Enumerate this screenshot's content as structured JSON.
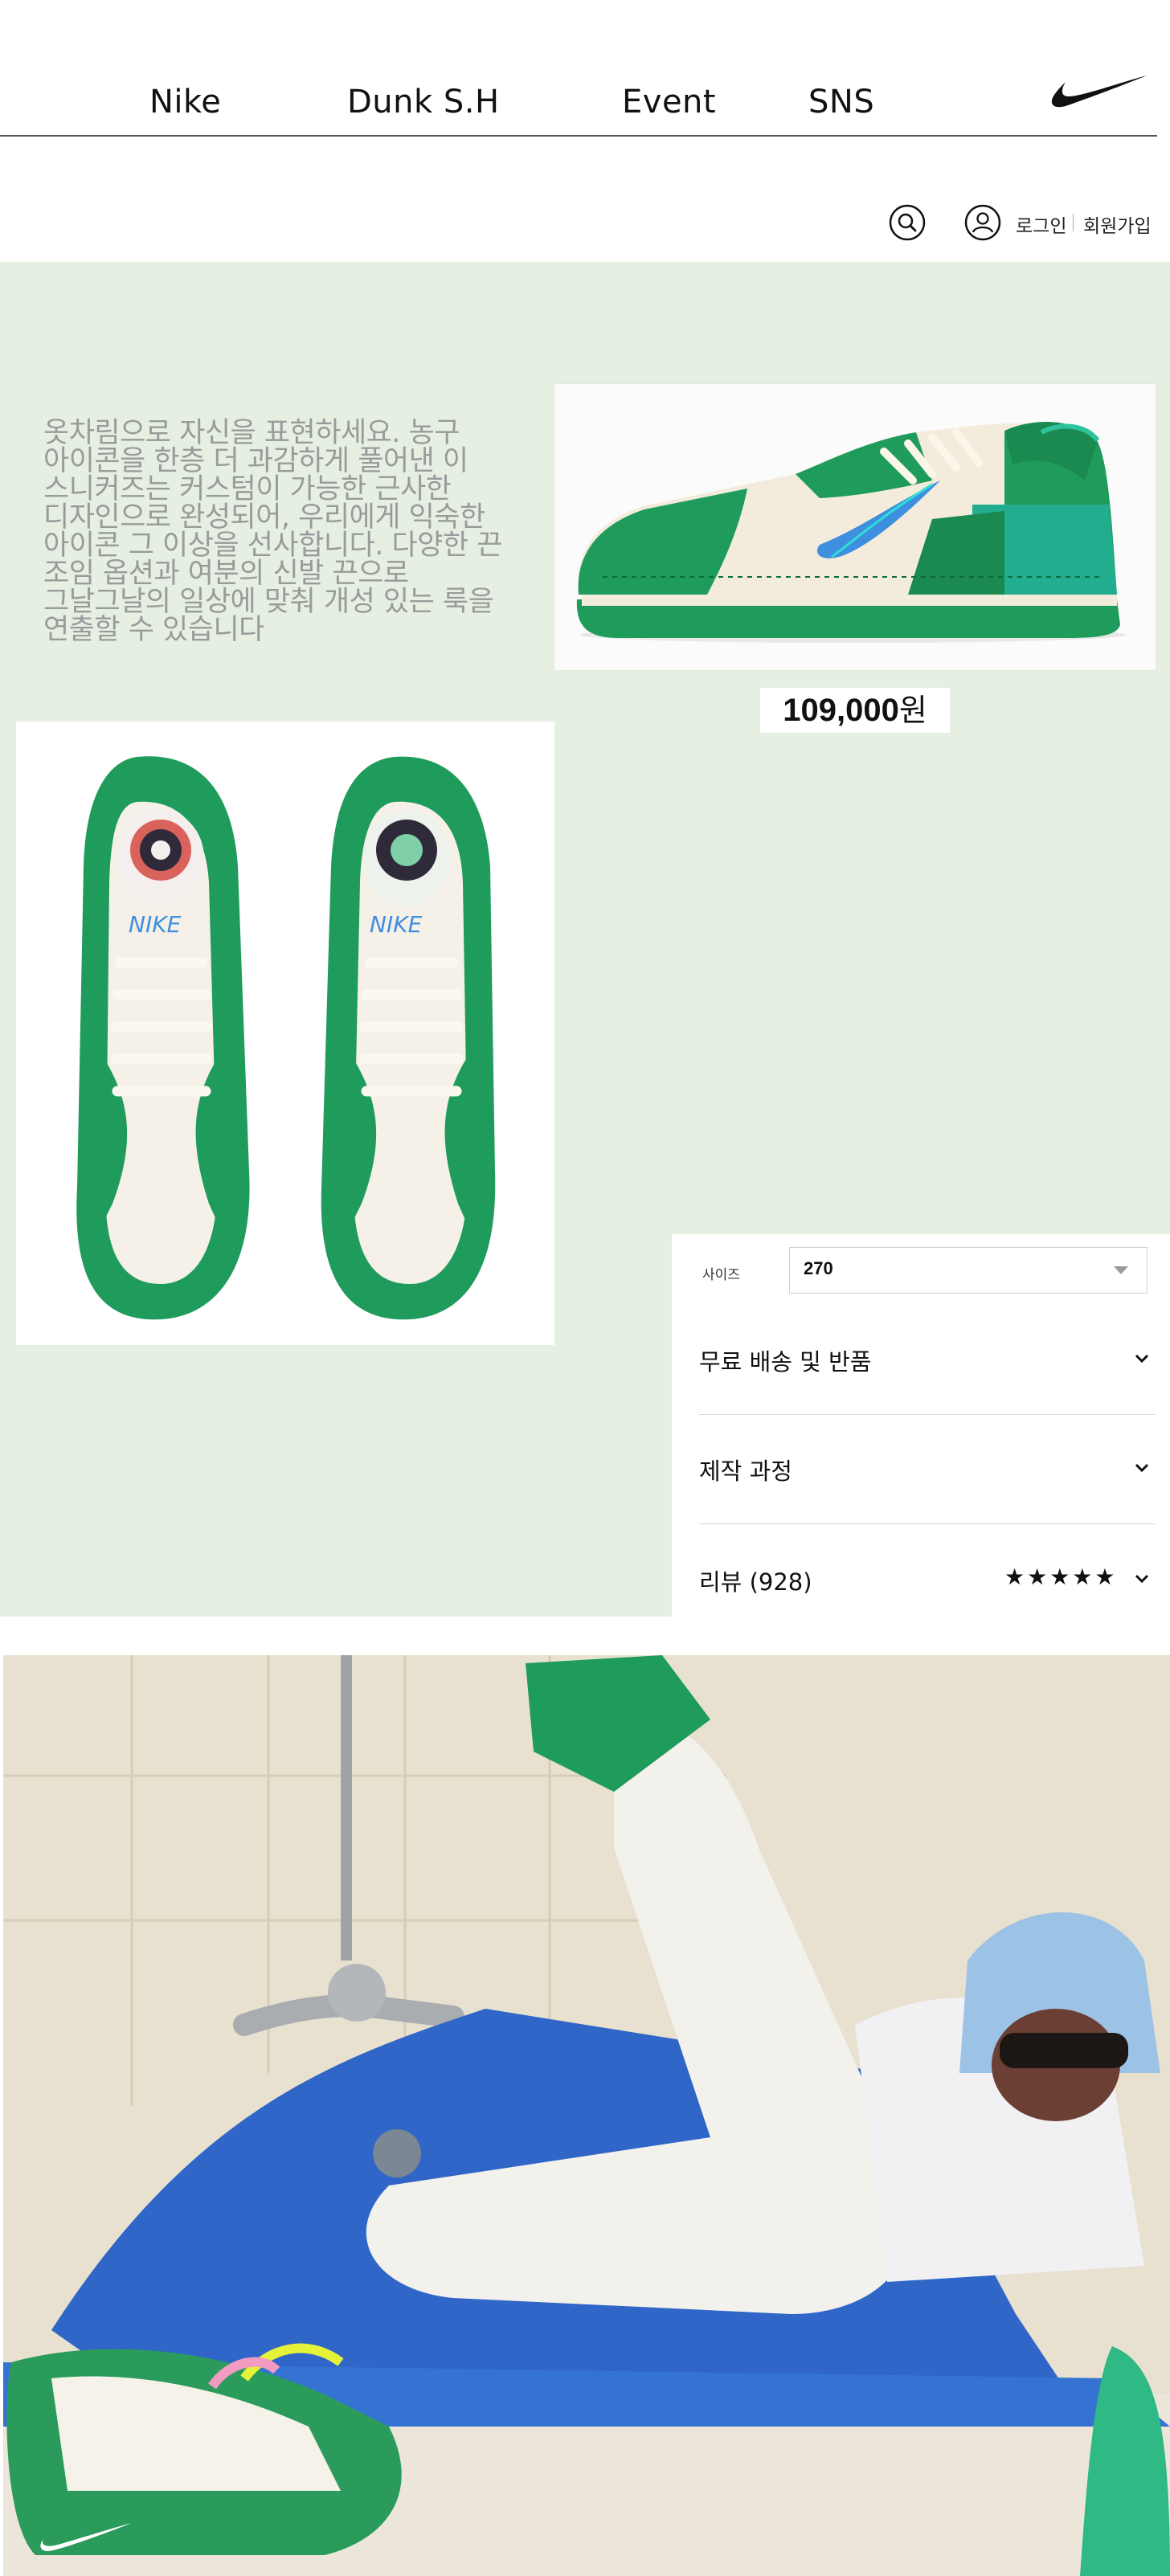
{
  "nav": {
    "links": [
      "Nike",
      "Dunk S.H",
      "Event",
      "SNS"
    ]
  },
  "utility": {
    "login": "로그인",
    "join": "회원가입"
  },
  "hero": {
    "description": "옷차림으로 자신을 표현하세요. 농구 아이콘을 한층 더 과감하게 풀어낸 이 스니커즈는 커스텀이 가능한 근사한 디자인으로 완성되어, 우리에게 익숙한 아이콘 그 이상을 선사합니다. 다양한 끈 조임 옵션과 여분의 신발 끈으로 그날그날의 일상에 맞춰 개성 있는 룩을 연출할 수 있습니다",
    "price_value": "109,000",
    "price_unit": "원"
  },
  "options": {
    "size_label": "사이즈",
    "size_selected": "270",
    "accordion": [
      {
        "label": "무료 배송 및 반품"
      },
      {
        "label": "제작 과정"
      },
      {
        "label": "리뷰 (928)",
        "stars": "★★★★★"
      }
    ]
  },
  "colors": {
    "hero_bg": "#e5f0e2",
    "shoe_green": "#1f9b5c",
    "accent_blue": "#3f8fe0"
  },
  "icons": [
    "nike-swoosh-icon",
    "search-icon",
    "user-icon",
    "chevron-down-icon"
  ]
}
